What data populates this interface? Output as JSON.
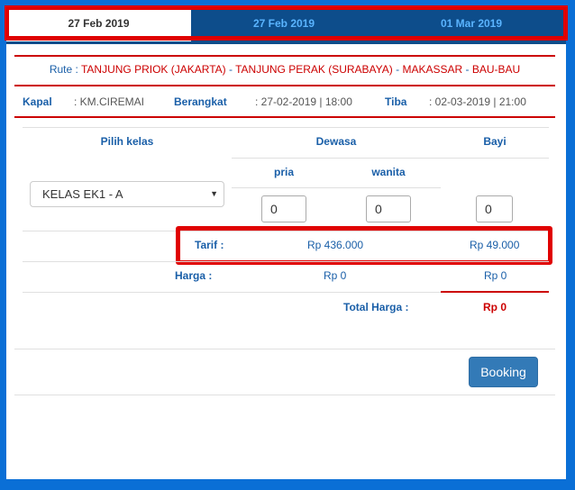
{
  "tabs": [
    {
      "label": "27 Feb 2019",
      "active": true
    },
    {
      "label": "27 Feb 2019",
      "active": false
    },
    {
      "label": "01 Mar 2019",
      "active": false
    }
  ],
  "route": {
    "label": "Rute :",
    "origin": "TANJUNG PRIOK (JAKARTA)",
    "sep1": " - ",
    "via1": "TANJUNG PERAK (SURABAYA)",
    "sep2": " - ",
    "via2": "MAKASSAR",
    "sep3": " - ",
    "destination": "BAU-BAU"
  },
  "trip": {
    "kapal_label": "Kapal",
    "kapal_value": ": KM.CIREMAI",
    "berangkat_label": "Berangkat",
    "berangkat_value": ": 27-02-2019 | 18:00",
    "tiba_label": "Tiba",
    "tiba_value": ": 02-03-2019 | 21:00"
  },
  "table": {
    "pilih_kelas": "Pilih kelas",
    "dewasa": "Dewasa",
    "bayi": "Bayi",
    "pria": "pria",
    "wanita": "wanita"
  },
  "class_select": {
    "selected": "KELAS EK1 - A"
  },
  "quantities": {
    "pria": "0",
    "wanita": "0",
    "bayi": "0"
  },
  "tarif": {
    "label": "Tarif :",
    "dewasa": "Rp 436.000",
    "bayi": "Rp 49.000"
  },
  "harga": {
    "label": "Harga :",
    "dewasa": "Rp 0",
    "bayi": "Rp 0"
  },
  "total": {
    "label": "Total Harga :",
    "value": "Rp 0"
  },
  "booking_button": "Booking",
  "colors": {
    "accent": "#337ab7",
    "highlight": "#e00000",
    "route_red": "#cc0000",
    "tab_bar": "#0d4d8b",
    "background": "#0a6fd6"
  }
}
